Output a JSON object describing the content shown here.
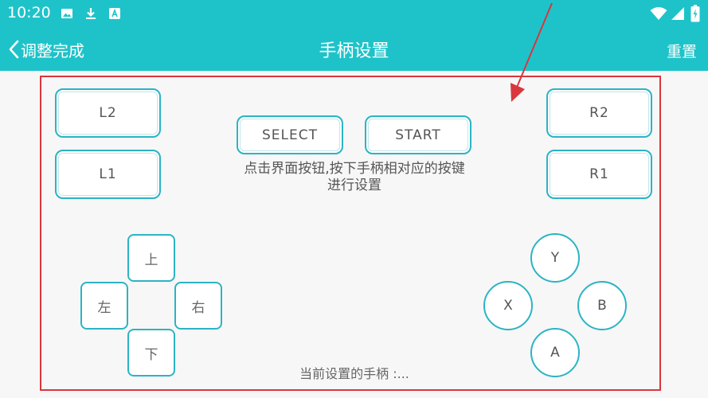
{
  "status_bar": {
    "time": "10:20",
    "left_icons": [
      "image-icon",
      "download-icon",
      "a-box-icon"
    ],
    "right_icons": [
      "wifi-icon",
      "signal-icon",
      "battery-charging-icon"
    ]
  },
  "app_bar": {
    "back_label": "调整完成",
    "title": "手柄设置",
    "reset_label": "重置"
  },
  "buttons": {
    "l2": "L2",
    "l1": "L1",
    "r2": "R2",
    "r1": "R1",
    "select": "SELECT",
    "start": "START",
    "up": "上",
    "down": "下",
    "left": "左",
    "right": "右",
    "y": "Y",
    "x": "X",
    "b": "B",
    "a": "A"
  },
  "hint": {
    "line1": "点击界面按钮,按下手柄相对应的按键",
    "line2": "进行设置"
  },
  "current_controller": "当前设置的手柄 :...",
  "colors": {
    "accent": "#1ec3c9",
    "button_border": "#2bb4c4",
    "frame_border": "#d9363e"
  }
}
